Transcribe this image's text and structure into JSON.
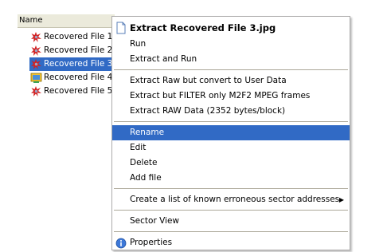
{
  "header": {
    "name_label": "Name"
  },
  "files": [
    {
      "label": "Recovered File 1.",
      "icon": "error-file-icon",
      "selected": false
    },
    {
      "label": "Recovered File 2.",
      "icon": "error-file-icon",
      "selected": false
    },
    {
      "label": "Recovered File 3.",
      "icon": "error-file-icon",
      "selected": true
    },
    {
      "label": "Recovered File 4.",
      "icon": "image-file-icon",
      "selected": false
    },
    {
      "label": "Recovered File 5.",
      "icon": "error-file-icon",
      "selected": false
    }
  ],
  "context_menu": {
    "extract_label": "Extract Recovered File 3.jpg",
    "run_label": "Run",
    "extract_run_label": "Extract and Run",
    "extract_raw_user_label": "Extract Raw but convert to User Data",
    "extract_filter_label": "Extract but FILTER only M2F2 MPEG frames",
    "extract_raw_label": "Extract RAW Data (2352 bytes/block)",
    "rename_label": "Rename",
    "edit_label": "Edit",
    "delete_label": "Delete",
    "add_file_label": "Add file",
    "error_list_label": "Create a list of known erroneous sector addresses",
    "sector_view_label": "Sector View",
    "properties_label": "Properties",
    "highlighted_item": "Rename"
  },
  "colors": {
    "selection": "#316ac5",
    "header_bg": "#ebeadb",
    "menu_border": "#acabab"
  }
}
